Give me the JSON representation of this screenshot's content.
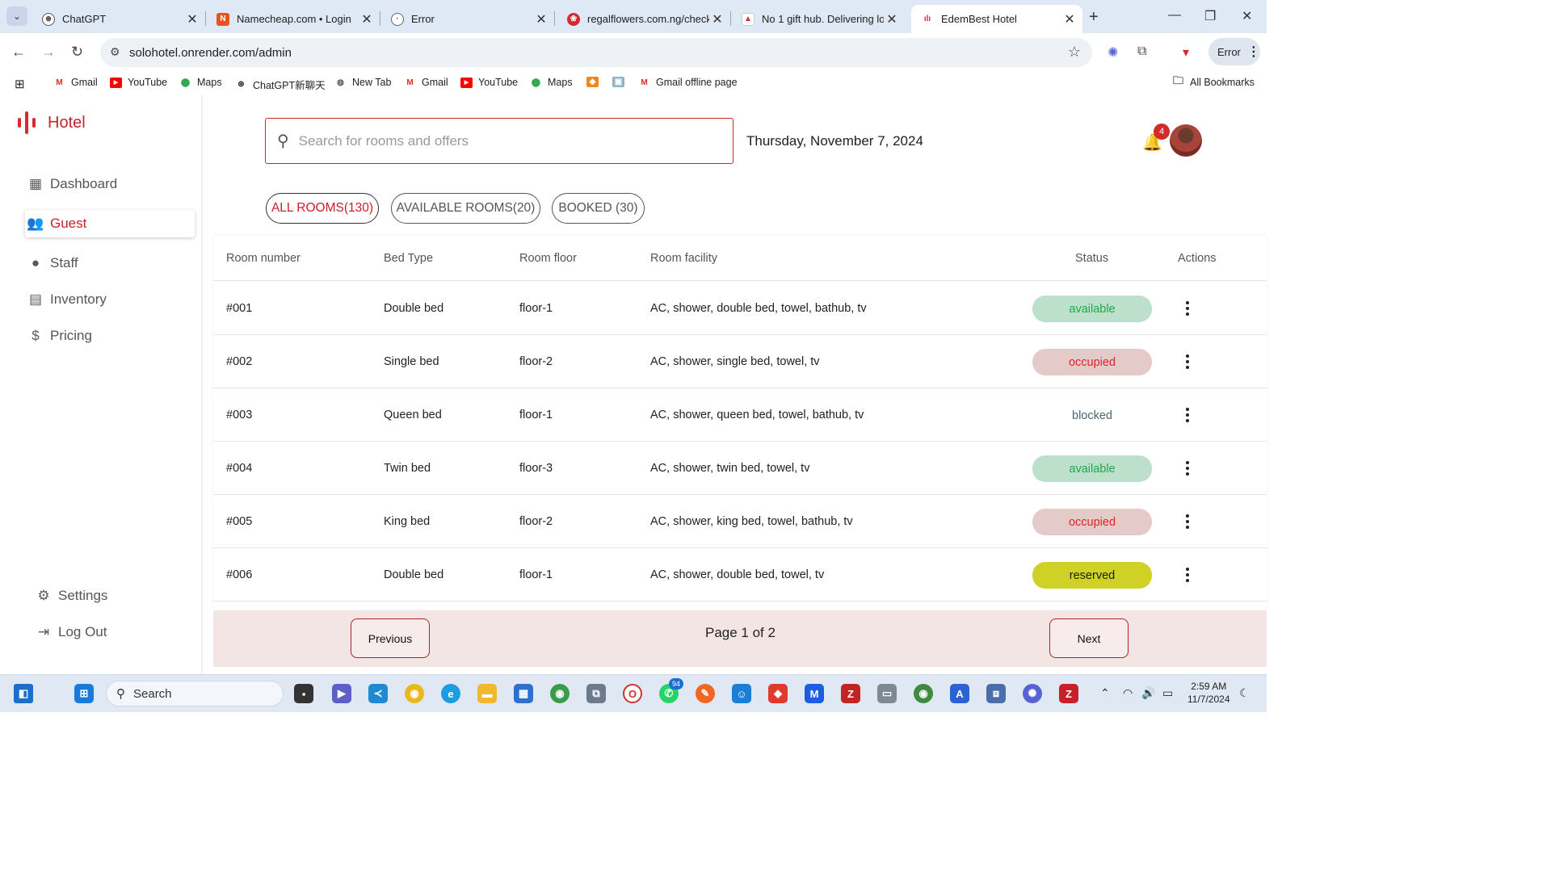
{
  "browser": {
    "tabs": [
      {
        "title": "ChatGPT",
        "icon": "chatgpt-icon"
      },
      {
        "title": "Namecheap.com • Login",
        "icon": "namecheap-icon"
      },
      {
        "title": "Error",
        "icon": "globe-icon"
      },
      {
        "title": "regalflowers.com.ng/check",
        "icon": "regalflowers-icon"
      },
      {
        "title": "No 1 gift hub. Delivering lo",
        "icon": "gift-icon"
      },
      {
        "title": "EdemBest Hotel",
        "icon": "hotel-icon"
      }
    ],
    "url": "solohotel.onrender.com/admin",
    "profile_label": "Error",
    "bookmarks": [
      "Gmail",
      "YouTube",
      "Maps",
      "ChatGPT新聊天",
      "New Tab",
      "Gmail",
      "YouTube",
      "Maps",
      "Gmail offline page"
    ],
    "all_bookmarks_label": "All Bookmarks"
  },
  "app": {
    "brand": "Hotel",
    "nav": [
      {
        "label": "Dashboard",
        "icon": "dashboard-icon"
      },
      {
        "label": "Guest",
        "icon": "guests-icon",
        "active": true
      },
      {
        "label": "Staff",
        "icon": "person-icon"
      },
      {
        "label": "Inventory",
        "icon": "inventory-box-icon"
      },
      {
        "label": "Pricing",
        "icon": "pricing-icon"
      }
    ],
    "bottom_nav": [
      {
        "label": "Settings",
        "icon": "gear-icon"
      },
      {
        "label": "Log Out",
        "icon": "logout-icon"
      }
    ],
    "search_placeholder": "Search for rooms and offers",
    "date": "Thursday, November 7, 2024",
    "notification_count": "4",
    "filters": [
      {
        "label": "ALL ROOMS(130)",
        "active": true
      },
      {
        "label": "AVAILABLE ROOMS(20)"
      },
      {
        "label": "BOOKED (30)"
      }
    ],
    "columns": [
      "Room number",
      "Bed Type",
      "Room floor",
      "Room facility",
      "Status",
      "Actions"
    ],
    "rows": [
      {
        "room": "#001",
        "bed": "Double bed",
        "floor": "floor-1",
        "facility": "AC, shower, double bed, towel, bathub, tv",
        "status": "available"
      },
      {
        "room": "#002",
        "bed": "Single bed",
        "floor": "floor-2",
        "facility": "AC, shower, single bed, towel, tv",
        "status": "occupied"
      },
      {
        "room": "#003",
        "bed": "Queen bed",
        "floor": "floor-1",
        "facility": "AC, shower, queen bed, towel, bathub, tv",
        "status": "blocked"
      },
      {
        "room": "#004",
        "bed": "Twin bed",
        "floor": "floor-3",
        "facility": "AC, shower, twin bed, towel, tv",
        "status": "available"
      },
      {
        "room": "#005",
        "bed": "King bed",
        "floor": "floor-2",
        "facility": "AC, shower, king bed, towel, bathub, tv",
        "status": "occupied"
      },
      {
        "room": "#006",
        "bed": "Double bed",
        "floor": "floor-1",
        "facility": "AC, shower, double bed, towel, tv",
        "status": "reserved"
      }
    ],
    "pagination": {
      "previous": "Previous",
      "next": "Next",
      "info": "Page 1 of 2"
    },
    "colors": {
      "accent": "#c8202a",
      "available_bg": "#bde0cd",
      "occupied_bg": "#e5caca",
      "reserved_bg": "#cfd126"
    }
  },
  "taskbar": {
    "search_label": "Search",
    "whatsapp_badge": "94",
    "time": "2:59 AM",
    "date": "11/7/2024"
  }
}
